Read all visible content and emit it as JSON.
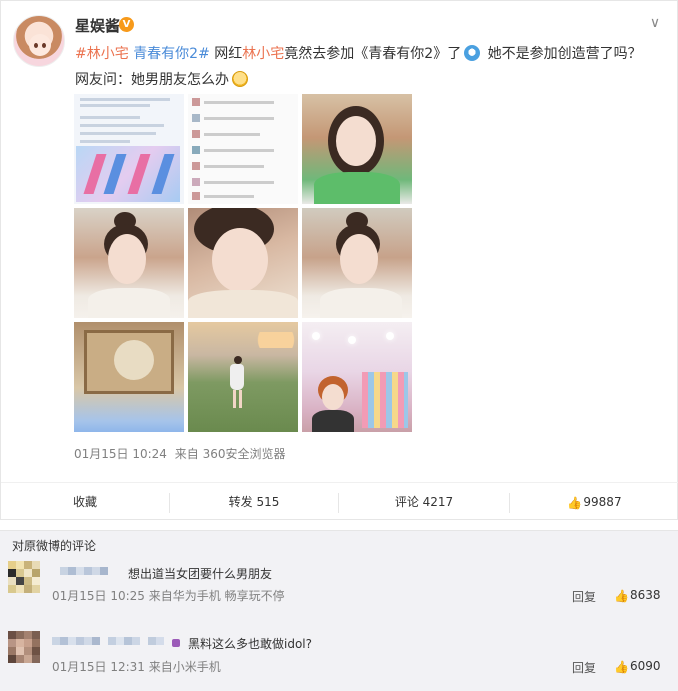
{
  "post": {
    "username": "星娱酱",
    "verified_badge": "V",
    "hashtag1": "#林小宅",
    "hashtag2": "青春有你2#",
    "text1": " 网红",
    "name_link": "林小宅",
    "text2": "竟然去参加《青春有你2》了",
    "text3": " 她不是参加创造营了吗？网友问：她男朋友怎么办",
    "timestamp": "01月15日 10:24",
    "source": "来自 360安全浏览器"
  },
  "actions": {
    "favorite": "收藏",
    "repost": "转发 515",
    "comment": "评论 4217",
    "like": "99887"
  },
  "comments_section": {
    "title": "对原微博的评论",
    "items": [
      {
        "text": "想出道当女团要什么男朋友",
        "meta": "01月15日 10:25 来自华为手机 畅享玩不停",
        "reply": "回复",
        "likes": "8638"
      },
      {
        "text": "黑料这么多也敢做idol?",
        "meta": "01月15日 12:31 来自小米手机",
        "reply": "回复",
        "likes": "6090"
      }
    ]
  },
  "icons": {
    "chevron": "chevron-down-icon",
    "thumb": "thumbs-up-icon"
  }
}
